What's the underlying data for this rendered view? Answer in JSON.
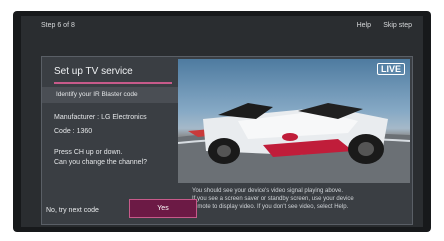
{
  "topbar": {
    "step": "Step 6 of 8",
    "help": "Help",
    "skip": "Skip step"
  },
  "setup": {
    "title": "Set up TV service",
    "subtitle": "Identify your IR Blaster code",
    "manufacturer": "Manufacturer : LG Electronics",
    "code": "Code : 1360",
    "prompt_line1": "Press CH up or down.",
    "prompt_line2": "Can you change the channel?"
  },
  "video": {
    "live_badge": "LIVE"
  },
  "info": {
    "line1": "You should see your device's video signal playing above.",
    "line2": "If you see a screen saver or standby screen, use your device",
    "line3": "remote to display video. If you don't see video, select Help."
  },
  "buttons": {
    "next": "No, try next code",
    "yes": "Yes"
  },
  "colors": {
    "accent": "#c75a8a",
    "selected_button": "#6c1a45",
    "panel": "#3a3e43",
    "background": "#2a2d30"
  }
}
